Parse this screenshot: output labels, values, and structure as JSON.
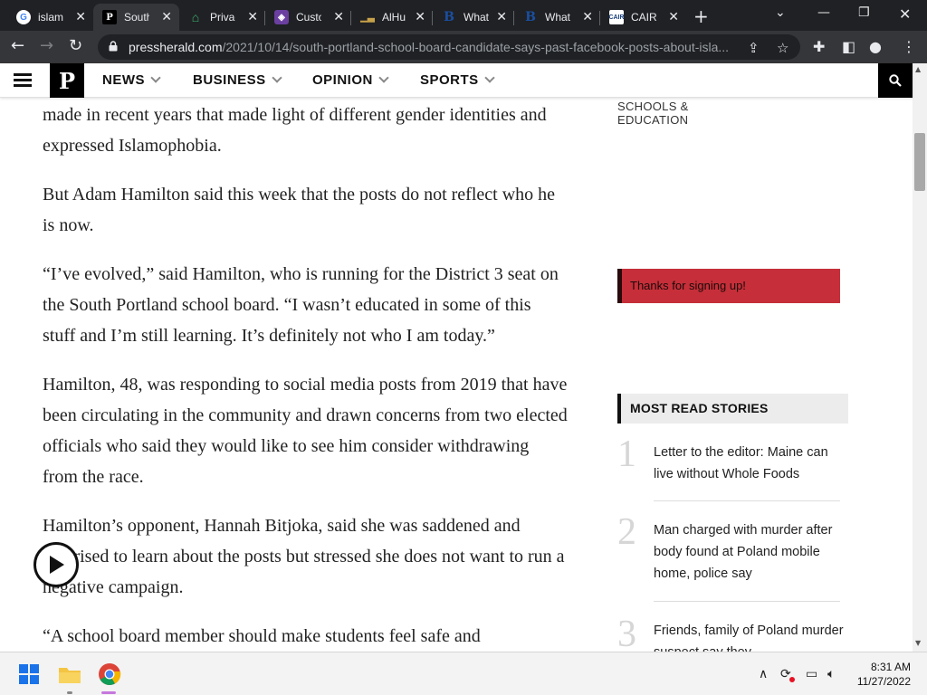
{
  "browser": {
    "tabs": [
      {
        "title": "islam",
        "icon": "google-icon",
        "active": false
      },
      {
        "title": "South",
        "icon": "pressherald-icon",
        "active": true
      },
      {
        "title": "Privac",
        "icon": "house-icon",
        "active": false
      },
      {
        "title": "Custo",
        "icon": "shield-crest-icon",
        "active": false
      },
      {
        "title": "AlHu",
        "icon": "chart-icon",
        "active": false
      },
      {
        "title": "What",
        "icon": "b-icon",
        "active": false
      },
      {
        "title": "What",
        "icon": "b-icon",
        "active": false
      },
      {
        "title": "CAIR",
        "icon": "cair-icon",
        "active": false
      }
    ],
    "url_host": "pressherald.com",
    "url_path": "/2021/10/14/south-portland-school-board-candidate-says-past-facebook-posts-about-isla..."
  },
  "site_nav": {
    "logo": "P",
    "menu": [
      "NEWS",
      "BUSINESS",
      "OPINION",
      "SPORTS"
    ]
  },
  "article": {
    "paragraphs": [
      "made in recent years that made light of different gender identities and expressed Islamophobia.",
      "But Adam Hamilton said this week that the posts do not reflect who he is now.",
      "“I’ve evolved,” said Hamilton, who is running for the District 3 seat on the South Portland school board. “I wasn’t educated in some of this stuff and I’m still learning. It’s definitely not who I am today.”",
      "Hamilton, 48, was responding to social media posts from 2019 that have been circulating in the community and drawn concerns from two elected officials who said they would like to see him consider withdrawing from the race.",
      "Hamilton’s opponent, Hannah Bitjoka, said she was saddened and surprised to learn about the posts but stressed she does not want to run a negative campaign.",
      "“A school board member should make students feel safe and"
    ]
  },
  "sidebar": {
    "category_line1": "SCHOOLS &",
    "category_line2": "EDUCATION",
    "signup_message": "Thanks for signing up!",
    "most_read_title": "MOST READ STORIES",
    "stories": [
      {
        "num": "1",
        "title": "Letter to the editor: Maine can live without Whole Foods"
      },
      {
        "num": "2",
        "title": "Man charged with murder after body found at Poland mobile home, police say"
      },
      {
        "num": "3",
        "title": "Friends, family of Poland murder suspect say they"
      }
    ]
  },
  "taskbar": {
    "time": "8:31 AM",
    "date": "11/27/2022"
  }
}
